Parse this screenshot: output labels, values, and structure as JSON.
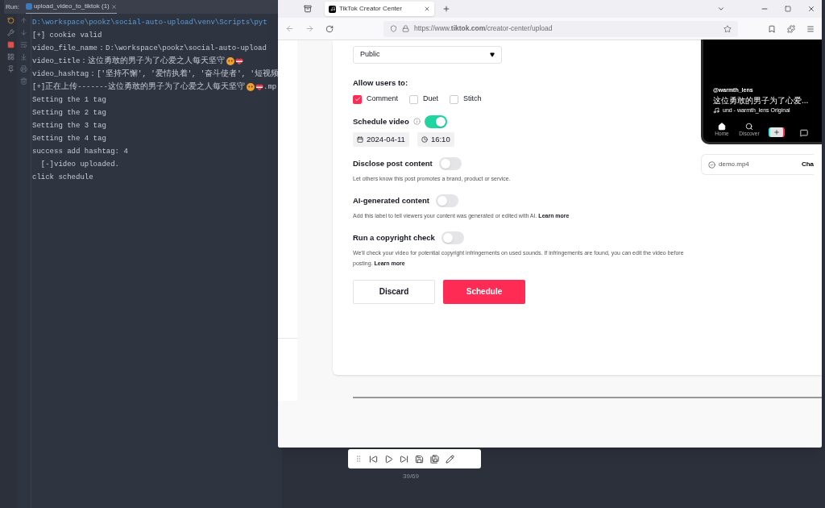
{
  "ide": {
    "run_label": "Run:",
    "tab_title": "upload_video_to_tiktok (1)",
    "console_lines": [
      {
        "text": "D:\\workspace\\pookz\\social-auto-upload\\venv\\Scripts\\pyt",
        "kind": "path",
        "emoji": false
      },
      {
        "text": "[+] cookie valid",
        "kind": "plain",
        "emoji": false
      },
      {
        "text": "video_file_name：D:\\workspace\\pookz\\social-auto-upload",
        "kind": "plain",
        "emoji": false
      },
      {
        "text": "video_title：这位勇敢的男子为了心爱之人每天坚守",
        "kind": "plain",
        "emoji": true
      },
      {
        "text": "video_hashtag：['坚持不懈', '爱情执着', '奋斗使者', '短视频",
        "kind": "plain",
        "emoji": false
      },
      {
        "text": "[+]正在上传-------这位勇敢的男子为了心爱之人每天坚守",
        "kind": "plain",
        "emoji": true,
        "suffix": ".mp"
      },
      {
        "text": "Setting the 1 tag",
        "kind": "plain",
        "emoji": false
      },
      {
        "text": "Setting the 2 tag",
        "kind": "plain",
        "emoji": false
      },
      {
        "text": "Setting the 3 tag",
        "kind": "plain",
        "emoji": false
      },
      {
        "text": "Setting the 4 tag",
        "kind": "plain",
        "emoji": false
      },
      {
        "text": "success add hashtag: 4",
        "kind": "plain",
        "emoji": false
      },
      {
        "text": "  [-]video uploaded.",
        "kind": "plain",
        "emoji": false
      },
      {
        "text": "click schedule",
        "kind": "plain",
        "emoji": false
      }
    ]
  },
  "browser": {
    "tab_title": "TikTok Creator Center",
    "url": "https://www.**tiktok.com**/creator-center/upload",
    "page": {
      "visibility": "Public",
      "allow_label": "Allow users to:",
      "permissions": [
        {
          "label": "Comment",
          "checked": true
        },
        {
          "label": "Duet",
          "checked": false
        },
        {
          "label": "Stitch",
          "checked": false
        }
      ],
      "schedule": {
        "label": "Schedule video",
        "on": true,
        "date": "2024-04-11",
        "time": "16:10"
      },
      "toggles": [
        {
          "title": "Disclose post content",
          "on": false,
          "description": "Let others know this post promotes a brand, product or service."
        },
        {
          "title": "AI-generated content",
          "on": false,
          "description": "Add this label to tell viewers your content was generated or edited with AI.",
          "link": "Learn more"
        },
        {
          "title": "Run a copyright check",
          "on": false,
          "description": "We'll check your video for potential copyright infringements on used sounds. If infringements are found, you can edit the video before posting.",
          "link": "Learn more"
        }
      ],
      "buttons": [
        {
          "label": "Discard",
          "kind": "secondary"
        },
        {
          "label": "Schedule",
          "kind": "primary"
        }
      ],
      "preview": {
        "handle": "@warmth_lens",
        "caption": "这位勇敢的男子为了心爱...",
        "sound": "und - warmth_lens Original",
        "nav": [
          {
            "label": "Home",
            "kind": "home"
          },
          {
            "label": "Discover",
            "kind": "discover"
          },
          {
            "kind": "create"
          },
          {
            "kind": "inbox"
          }
        ]
      },
      "file": {
        "name": "demo.mp4",
        "action": "Cha"
      }
    }
  },
  "player": {
    "counter": "39/69"
  }
}
